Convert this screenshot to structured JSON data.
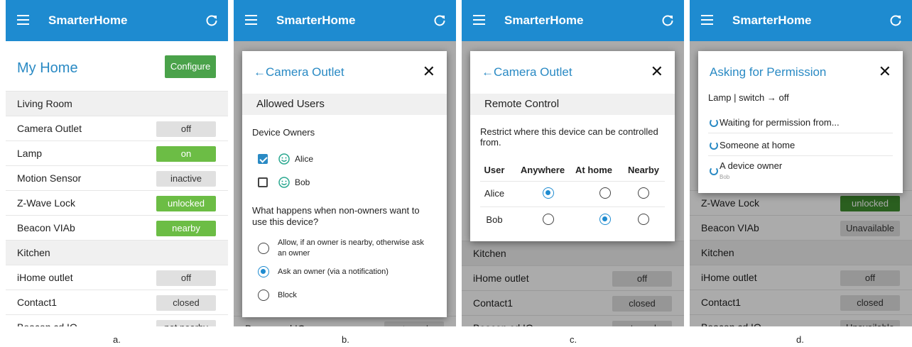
{
  "app": {
    "title": "SmarterHome",
    "menu_icon": "hamburger-menu-icon",
    "refresh_icon": "refresh-icon",
    "accent": "#1e8bd0",
    "green": "#6cbd45"
  },
  "home": {
    "title": "My Home",
    "configure_label": "Configure",
    "rows_a": [
      {
        "kind": "section",
        "label": "Living Room"
      },
      {
        "kind": "device",
        "label": "Camera Outlet",
        "state": "off",
        "tone": "grey"
      },
      {
        "kind": "device",
        "label": "Lamp",
        "state": "on",
        "tone": "green"
      },
      {
        "kind": "device",
        "label": "Motion Sensor",
        "state": "inactive",
        "tone": "grey"
      },
      {
        "kind": "device",
        "label": "Z-Wave Lock",
        "state": "unlocked",
        "tone": "green"
      },
      {
        "kind": "device",
        "label": "Beacon VIAb",
        "state": "nearby",
        "tone": "green"
      },
      {
        "kind": "section",
        "label": "Kitchen"
      },
      {
        "kind": "device",
        "label": "iHome outlet",
        "state": "off",
        "tone": "grey"
      },
      {
        "kind": "device",
        "label": "Contact1",
        "state": "closed",
        "tone": "grey"
      },
      {
        "kind": "device",
        "label": "Beacon cd IO",
        "state": "not nearby",
        "tone": "grey"
      }
    ],
    "rows_b": [
      {
        "kind": "device",
        "label": "Beacon cd IO",
        "state": "not nearby",
        "tone": "grey"
      }
    ],
    "rows_c": [
      {
        "kind": "section",
        "label": "Kitchen"
      },
      {
        "kind": "device",
        "label": "iHome outlet",
        "state": "off",
        "tone": "grey"
      },
      {
        "kind": "device",
        "label": "Contact1",
        "state": "closed",
        "tone": "grey"
      },
      {
        "kind": "device",
        "label": "Beacon cd IO",
        "state": "not nearby",
        "tone": "grey"
      }
    ],
    "rows_d": [
      {
        "kind": "device",
        "label": "Z-Wave Lock",
        "state": "unlocked",
        "tone": "darkgreen"
      },
      {
        "kind": "device",
        "label": "Beacon VIAb",
        "state": "Unavailable",
        "tone": "grey"
      },
      {
        "kind": "section",
        "label": "Kitchen"
      },
      {
        "kind": "device",
        "label": "iHome outlet",
        "state": "off",
        "tone": "grey"
      },
      {
        "kind": "device",
        "label": "Contact1",
        "state": "closed",
        "tone": "grey"
      },
      {
        "kind": "device",
        "label": "Beacon cd IO",
        "state": "Unavailable",
        "tone": "grey"
      }
    ]
  },
  "dialog_b": {
    "title": "←Camera Outlet",
    "close": "✕",
    "section": "Allowed Users",
    "owners_heading": "Device Owners",
    "owners": [
      {
        "name": "Alice",
        "checked": true
      },
      {
        "name": "Bob",
        "checked": false
      }
    ],
    "question": "What happens when non-owners want to use this device?",
    "options": [
      {
        "label": "Allow, if an owner is nearby, otherwise ask an owner",
        "selected": false
      },
      {
        "label": "Ask an owner (via a notification)",
        "selected": true
      },
      {
        "label": "Block",
        "selected": false
      }
    ]
  },
  "dialog_c": {
    "title": "←Camera Outlet",
    "close": "✕",
    "section": "Remote Control",
    "description": "Restrict where this device can be controlled from.",
    "columns": [
      "User",
      "Anywhere",
      "At home",
      "Nearby"
    ],
    "rows": [
      {
        "user": "Alice",
        "selected": "Anywhere"
      },
      {
        "user": "Bob",
        "selected": "At home"
      }
    ]
  },
  "dialog_d": {
    "title": "Asking for Permission",
    "close": "✕",
    "summary": "Lamp | switch → off",
    "items": [
      {
        "text": "Waiting for permission from...",
        "sub": ""
      },
      {
        "text": "Someone at home",
        "sub": ""
      },
      {
        "text": "A device owner",
        "sub": "Bob"
      }
    ]
  },
  "captions": [
    "a.",
    "b.",
    "c.",
    "d."
  ]
}
